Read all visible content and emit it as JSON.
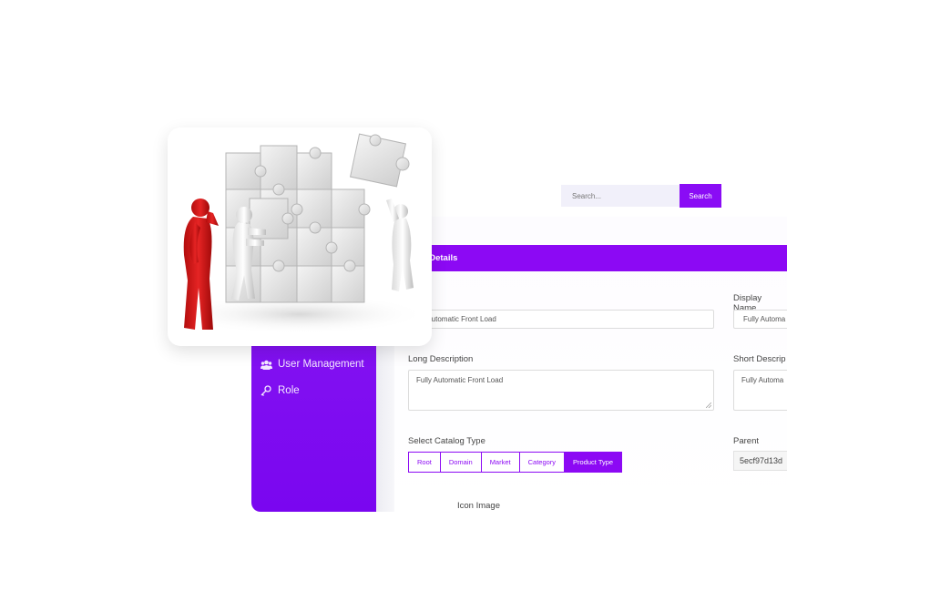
{
  "search": {
    "placeholder": "Search...",
    "button_label": "Search"
  },
  "sidebar": {
    "items": [
      {
        "label": "User Management",
        "icon": "users-icon"
      },
      {
        "label": "Role",
        "icon": "key-icon"
      }
    ]
  },
  "form": {
    "header_title": "og Details",
    "labels": {
      "name": "",
      "display_name": "Display Name",
      "long_description": "Long Description",
      "short_description": "Short Descrip",
      "catalog_type": "Select Catalog Type",
      "parent": "Parent",
      "icon_image": "Icon Image"
    },
    "values": {
      "name": "lly Automatic Front Load",
      "display_name": "Fully Automa",
      "long_description": "Fully Automatic Front Load",
      "short_description": "Fully Automa",
      "parent": "5ecf97d13d"
    },
    "catalog_types": [
      {
        "label": "Root",
        "active": false
      },
      {
        "label": "Domain",
        "active": false
      },
      {
        "label": "Market",
        "active": false
      },
      {
        "label": "Category",
        "active": false
      },
      {
        "label": "Product Type",
        "active": true
      }
    ]
  },
  "colors": {
    "accent": "#8c09f4",
    "sidebar": "#8a1cf3"
  },
  "illustration": "puzzle-team-image"
}
